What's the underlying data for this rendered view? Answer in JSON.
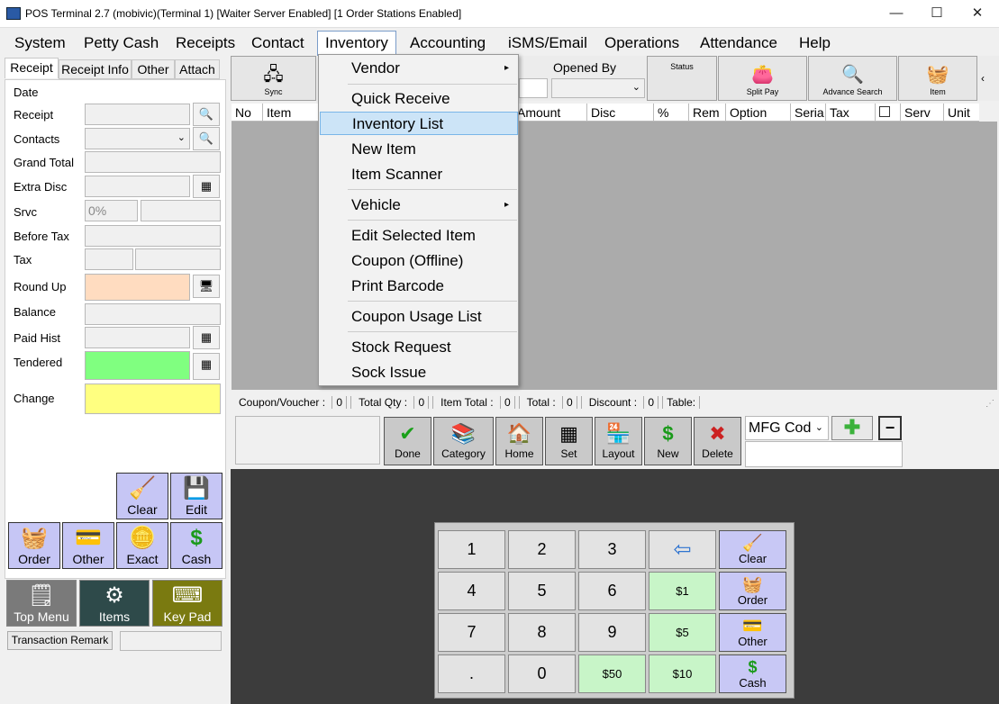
{
  "window": {
    "title": "POS Terminal 2.7 (mobivic)(Terminal 1) [Waiter Server Enabled] [1 Order Stations Enabled]",
    "minimize": "—",
    "maximize": "☐",
    "close": "✕"
  },
  "menubar": [
    "System",
    "Petty Cash",
    "Receipts",
    "Contact",
    "Inventory",
    "Accounting",
    "iSMS/Email",
    "Operations",
    "Attendance",
    "Help"
  ],
  "tabs": [
    "Receipt",
    "Receipt Info",
    "Other",
    "Attach"
  ],
  "fields": {
    "date": "Date",
    "receipt": "Receipt",
    "contacts": "Contacts",
    "grand_total": "Grand Total",
    "extra_disc": "Extra Disc",
    "srvc": "Srvc",
    "srvc_value": "0%",
    "before_tax": "Before Tax",
    "tax": "Tax",
    "round_up": "Round Up",
    "balance": "Balance",
    "paid_hist": "Paid Hist",
    "tendered": "Tendered",
    "change": "Change"
  },
  "left_buttons": {
    "clear": "Clear",
    "edit": "Edit",
    "order": "Order",
    "other": "Other",
    "exact": "Exact",
    "cash": "Cash",
    "top_menu": "Top Menu",
    "items": "Items",
    "key_pad": "Key Pad",
    "transaction_remark": "Transaction Remark"
  },
  "toolbar": {
    "sync": "Sync",
    "opened_by": "Opened By",
    "status": "Status",
    "split_pay": "Split Pay",
    "advance_search": "Advance Search",
    "item": "Item"
  },
  "grid_columns": [
    "No",
    "Item",
    "Amount",
    "Disc",
    "%",
    "Rem",
    "Option",
    "Seria",
    "Tax",
    "",
    "Serv",
    "Unit"
  ],
  "status_bar": {
    "coupon": "Coupon/Voucher : ",
    "coupon_v": "0",
    "total_qty": "Total Qty : ",
    "total_qty_v": "0",
    "item_total": "Item Total : ",
    "item_total_v": "0",
    "total": "Total : ",
    "total_v": "0",
    "discount": "Discount : ",
    "discount_v": "0",
    "table": "Table:"
  },
  "mid_buttons": [
    "Done",
    "Category",
    "Home",
    "Set",
    "Layout",
    "New",
    "Delete"
  ],
  "mfg_select": "MFG Cod",
  "keypad": {
    "k1": "1",
    "k2": "2",
    "k3": "3",
    "k4": "4",
    "k5": "5",
    "k6": "6",
    "k7": "7",
    "k8": "8",
    "k9": "9",
    "kdot": ".",
    "k0": "0",
    "d50": "$50",
    "d1": "$1",
    "d5": "$5",
    "d10": "$10",
    "clear": "Clear",
    "order": "Order",
    "other": "Other",
    "cash": "Cash"
  },
  "inventory_menu": {
    "vendor": "Vendor",
    "quick_receive": "Quick Receive",
    "inventory_list": "Inventory List",
    "new_item": "New Item",
    "item_scanner": "Item Scanner",
    "vehicle": "Vehicle",
    "edit_selected_item": "Edit Selected Item",
    "coupon_offline": "Coupon (Offline)",
    "print_barcode": "Print Barcode",
    "coupon_usage_list": "Coupon Usage List",
    "stock_request": "Stock Request",
    "sock_issue": "Sock Issue"
  },
  "colors": {
    "round_up": "#ffdcc0",
    "tendered": "#80ff80",
    "change": "#ffff80",
    "blue_button": "#c6c6f5",
    "highlight": "#cce4f7"
  }
}
